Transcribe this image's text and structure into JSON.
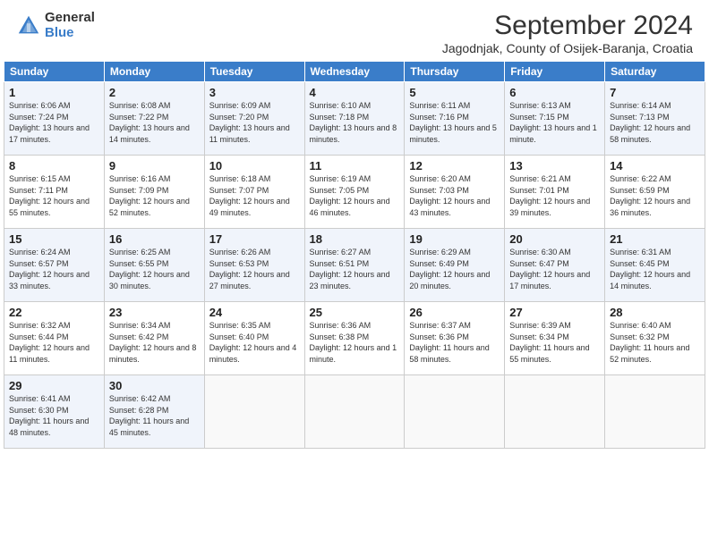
{
  "header": {
    "logo_general": "General",
    "logo_blue": "Blue",
    "month_title": "September 2024",
    "location": "Jagodnjak, County of Osijek-Baranja, Croatia"
  },
  "weekdays": [
    "Sunday",
    "Monday",
    "Tuesday",
    "Wednesday",
    "Thursday",
    "Friday",
    "Saturday"
  ],
  "weeks": [
    [
      {
        "day": 1,
        "rise": "6:06 AM",
        "set": "7:24 PM",
        "daylight": "13 hours and 17 minutes."
      },
      {
        "day": 2,
        "rise": "6:08 AM",
        "set": "7:22 PM",
        "daylight": "13 hours and 14 minutes."
      },
      {
        "day": 3,
        "rise": "6:09 AM",
        "set": "7:20 PM",
        "daylight": "13 hours and 11 minutes."
      },
      {
        "day": 4,
        "rise": "6:10 AM",
        "set": "7:18 PM",
        "daylight": "13 hours and 8 minutes."
      },
      {
        "day": 5,
        "rise": "6:11 AM",
        "set": "7:16 PM",
        "daylight": "13 hours and 5 minutes."
      },
      {
        "day": 6,
        "rise": "6:13 AM",
        "set": "7:15 PM",
        "daylight": "13 hours and 1 minute."
      },
      {
        "day": 7,
        "rise": "6:14 AM",
        "set": "7:13 PM",
        "daylight": "12 hours and 58 minutes."
      }
    ],
    [
      {
        "day": 8,
        "rise": "6:15 AM",
        "set": "7:11 PM",
        "daylight": "12 hours and 55 minutes."
      },
      {
        "day": 9,
        "rise": "6:16 AM",
        "set": "7:09 PM",
        "daylight": "12 hours and 52 minutes."
      },
      {
        "day": 10,
        "rise": "6:18 AM",
        "set": "7:07 PM",
        "daylight": "12 hours and 49 minutes."
      },
      {
        "day": 11,
        "rise": "6:19 AM",
        "set": "7:05 PM",
        "daylight": "12 hours and 46 minutes."
      },
      {
        "day": 12,
        "rise": "6:20 AM",
        "set": "7:03 PM",
        "daylight": "12 hours and 43 minutes."
      },
      {
        "day": 13,
        "rise": "6:21 AM",
        "set": "7:01 PM",
        "daylight": "12 hours and 39 minutes."
      },
      {
        "day": 14,
        "rise": "6:22 AM",
        "set": "6:59 PM",
        "daylight": "12 hours and 36 minutes."
      }
    ],
    [
      {
        "day": 15,
        "rise": "6:24 AM",
        "set": "6:57 PM",
        "daylight": "12 hours and 33 minutes."
      },
      {
        "day": 16,
        "rise": "6:25 AM",
        "set": "6:55 PM",
        "daylight": "12 hours and 30 minutes."
      },
      {
        "day": 17,
        "rise": "6:26 AM",
        "set": "6:53 PM",
        "daylight": "12 hours and 27 minutes."
      },
      {
        "day": 18,
        "rise": "6:27 AM",
        "set": "6:51 PM",
        "daylight": "12 hours and 23 minutes."
      },
      {
        "day": 19,
        "rise": "6:29 AM",
        "set": "6:49 PM",
        "daylight": "12 hours and 20 minutes."
      },
      {
        "day": 20,
        "rise": "6:30 AM",
        "set": "6:47 PM",
        "daylight": "12 hours and 17 minutes."
      },
      {
        "day": 21,
        "rise": "6:31 AM",
        "set": "6:45 PM",
        "daylight": "12 hours and 14 minutes."
      }
    ],
    [
      {
        "day": 22,
        "rise": "6:32 AM",
        "set": "6:44 PM",
        "daylight": "12 hours and 11 minutes."
      },
      {
        "day": 23,
        "rise": "6:34 AM",
        "set": "6:42 PM",
        "daylight": "12 hours and 8 minutes."
      },
      {
        "day": 24,
        "rise": "6:35 AM",
        "set": "6:40 PM",
        "daylight": "12 hours and 4 minutes."
      },
      {
        "day": 25,
        "rise": "6:36 AM",
        "set": "6:38 PM",
        "daylight": "12 hours and 1 minute."
      },
      {
        "day": 26,
        "rise": "6:37 AM",
        "set": "6:36 PM",
        "daylight": "11 hours and 58 minutes."
      },
      {
        "day": 27,
        "rise": "6:39 AM",
        "set": "6:34 PM",
        "daylight": "11 hours and 55 minutes."
      },
      {
        "day": 28,
        "rise": "6:40 AM",
        "set": "6:32 PM",
        "daylight": "11 hours and 52 minutes."
      }
    ],
    [
      {
        "day": 29,
        "rise": "6:41 AM",
        "set": "6:30 PM",
        "daylight": "11 hours and 48 minutes."
      },
      {
        "day": 30,
        "rise": "6:42 AM",
        "set": "6:28 PM",
        "daylight": "11 hours and 45 minutes."
      },
      null,
      null,
      null,
      null,
      null
    ]
  ]
}
